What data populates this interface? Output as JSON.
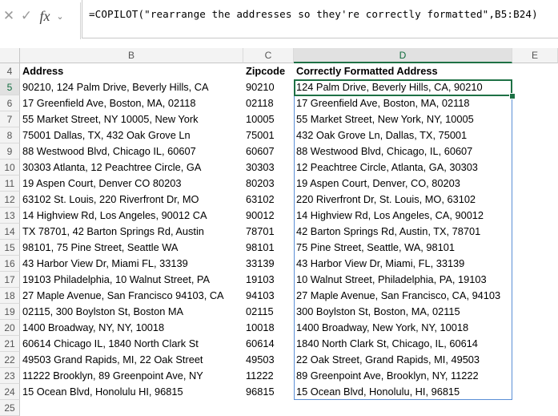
{
  "formula_bar": {
    "cancel_icon": "✕",
    "enter_icon": "✓",
    "fx_label": "fx",
    "chevron": "⌄",
    "formula": "=COPILOT(\"rearrange the addresses so they're correctly formatted\",B5:B24)"
  },
  "columns": [
    "B",
    "C",
    "D",
    "E"
  ],
  "header_row": {
    "number": "4",
    "address": "Address",
    "zipcode": "Zipcode",
    "formatted": "Correctly Formatted Address"
  },
  "rows": [
    {
      "n": "5",
      "address": "90210, 124 Palm Drive, Beverly Hills, CA",
      "zip": "90210",
      "formatted": "124 Palm Drive, Beverly Hills, CA, 90210"
    },
    {
      "n": "6",
      "address": "17 Greenfield Ave, Boston, MA, 02118",
      "zip": "02118",
      "formatted": "17 Greenfield Ave, Boston, MA, 02118"
    },
    {
      "n": "7",
      "address": "55 Market Street, NY 10005, New York",
      "zip": "10005",
      "formatted": "55 Market Street, New York, NY, 10005"
    },
    {
      "n": "8",
      "address": "75001 Dallas, TX, 432 Oak Grove Ln",
      "zip": "75001",
      "formatted": "432 Oak Grove Ln, Dallas, TX, 75001"
    },
    {
      "n": "9",
      "address": "88 Westwood Blvd, Chicago IL, 60607",
      "zip": "60607",
      "formatted": "88 Westwood Blvd, Chicago, IL, 60607"
    },
    {
      "n": "10",
      "address": "30303 Atlanta, 12 Peachtree Circle, GA",
      "zip": "30303",
      "formatted": "12 Peachtree Circle, Atlanta, GA, 30303"
    },
    {
      "n": "11",
      "address": "19 Aspen Court, Denver CO 80203",
      "zip": "80203",
      "formatted": "19 Aspen Court, Denver, CO, 80203"
    },
    {
      "n": "12",
      "address": "63102 St. Louis, 220 Riverfront Dr, MO",
      "zip": "63102",
      "formatted": "220 Riverfront Dr, St. Louis, MO, 63102"
    },
    {
      "n": "13",
      "address": "14 Highview Rd, Los Angeles, 90012 CA",
      "zip": "90012",
      "formatted": "14 Highview Rd, Los Angeles, CA, 90012"
    },
    {
      "n": "14",
      "address": "TX 78701, 42 Barton Springs Rd, Austin",
      "zip": "78701",
      "formatted": "42 Barton Springs Rd, Austin, TX, 78701"
    },
    {
      "n": "15",
      "address": "98101, 75 Pine Street, Seattle WA",
      "zip": "98101",
      "formatted": "75 Pine Street, Seattle, WA, 98101"
    },
    {
      "n": "16",
      "address": "43 Harbor View Dr, Miami FL, 33139",
      "zip": "33139",
      "formatted": "43 Harbor View Dr, Miami, FL, 33139"
    },
    {
      "n": "17",
      "address": "19103 Philadelphia, 10 Walnut Street, PA",
      "zip": "19103",
      "formatted": "10 Walnut Street, Philadelphia, PA, 19103"
    },
    {
      "n": "18",
      "address": "27 Maple Avenue, San Francisco 94103, CA",
      "zip": "94103",
      "formatted": "27 Maple Avenue, San Francisco, CA, 94103"
    },
    {
      "n": "19",
      "address": "02115, 300 Boylston St, Boston MA",
      "zip": "02115",
      "formatted": "300 Boylston St, Boston, MA, 02115"
    },
    {
      "n": "20",
      "address": "1400 Broadway, NY, NY, 10018",
      "zip": "10018",
      "formatted": "1400 Broadway, New York, NY, 10018"
    },
    {
      "n": "21",
      "address": "60614 Chicago IL, 1840 North Clark St",
      "zip": "60614",
      "formatted": "1840 North Clark St, Chicago, IL, 60614"
    },
    {
      "n": "22",
      "address": "49503 Grand Rapids, MI, 22 Oak Street",
      "zip": "49503",
      "formatted": "22 Oak Street, Grand Rapids, MI, 49503"
    },
    {
      "n": "23",
      "address": "11222 Brooklyn, 89 Greenpoint Ave, NY",
      "zip": "11222",
      "formatted": "89 Greenpoint Ave, Brooklyn, NY, 11222"
    },
    {
      "n": "24",
      "address": "15 Ocean Blvd, Honolulu HI, 96815",
      "zip": "96815",
      "formatted": "15 Ocean Blvd, Honolulu, HI, 96815"
    }
  ],
  "trailing_row": "25",
  "colors": {
    "selection": "#1e7145",
    "spill_border": "#5b8fd6",
    "header_bg": "#f3f3f3"
  }
}
